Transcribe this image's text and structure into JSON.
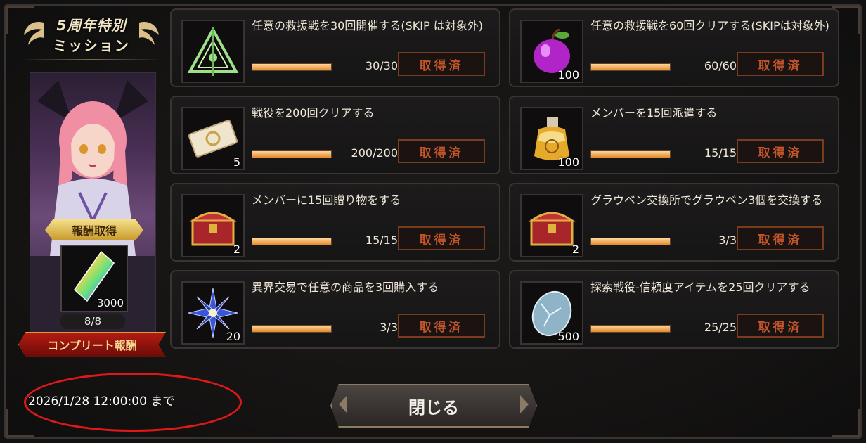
{
  "event": {
    "title_line1": "5周年特別",
    "title_line2": "ミッション",
    "reward_label": "報酬取得",
    "reward_qty": "3000",
    "progress": "8/8",
    "complete_label": "コンプリート報酬"
  },
  "missions": [
    {
      "title": "任意の救援戦を30回開催する(SKIP は対象外)",
      "qty": "",
      "count": "30/30",
      "progress": 1.0,
      "claim": "取得済",
      "icon": "emblem-icon"
    },
    {
      "title": "任意の救援戦を60回クリアする(SKIPは対象外)",
      "qty": "100",
      "count": "60/60",
      "progress": 1.0,
      "claim": "取得済",
      "icon": "apple-icon"
    },
    {
      "title": "戦役を200回クリアする",
      "qty": "5",
      "count": "200/200",
      "progress": 1.0,
      "claim": "取得済",
      "icon": "ticket-icon"
    },
    {
      "title": "メンバーを15回派遣する",
      "qty": "100",
      "count": "15/15",
      "progress": 1.0,
      "claim": "取得済",
      "icon": "potion-icon"
    },
    {
      "title": "メンバーに15回贈り物をする",
      "qty": "2",
      "count": "15/15",
      "progress": 1.0,
      "claim": "取得済",
      "icon": "chest-icon"
    },
    {
      "title": "グラウベン交換所でグラウベン3個を交換する",
      "qty": "2",
      "count": "3/3",
      "progress": 1.0,
      "claim": "取得済",
      "icon": "chest-icon"
    },
    {
      "title": "異界交易で任意の商品を3回購入する",
      "qty": "20",
      "count": "3/3",
      "progress": 1.0,
      "claim": "取得済",
      "icon": "star-flower-icon"
    },
    {
      "title": "探索戦役-信頼度アイテムを25回クリアする",
      "qty": "500",
      "count": "25/25",
      "progress": 1.0,
      "claim": "取得済",
      "icon": "crystal-egg-icon"
    }
  ],
  "deadline": "2026/1/28 12:00:00 まで",
  "close_label": "閉じる",
  "colors": {
    "accent": "#e48b2c",
    "claimed_text": "#c2542a",
    "highlight": "#e01818"
  }
}
